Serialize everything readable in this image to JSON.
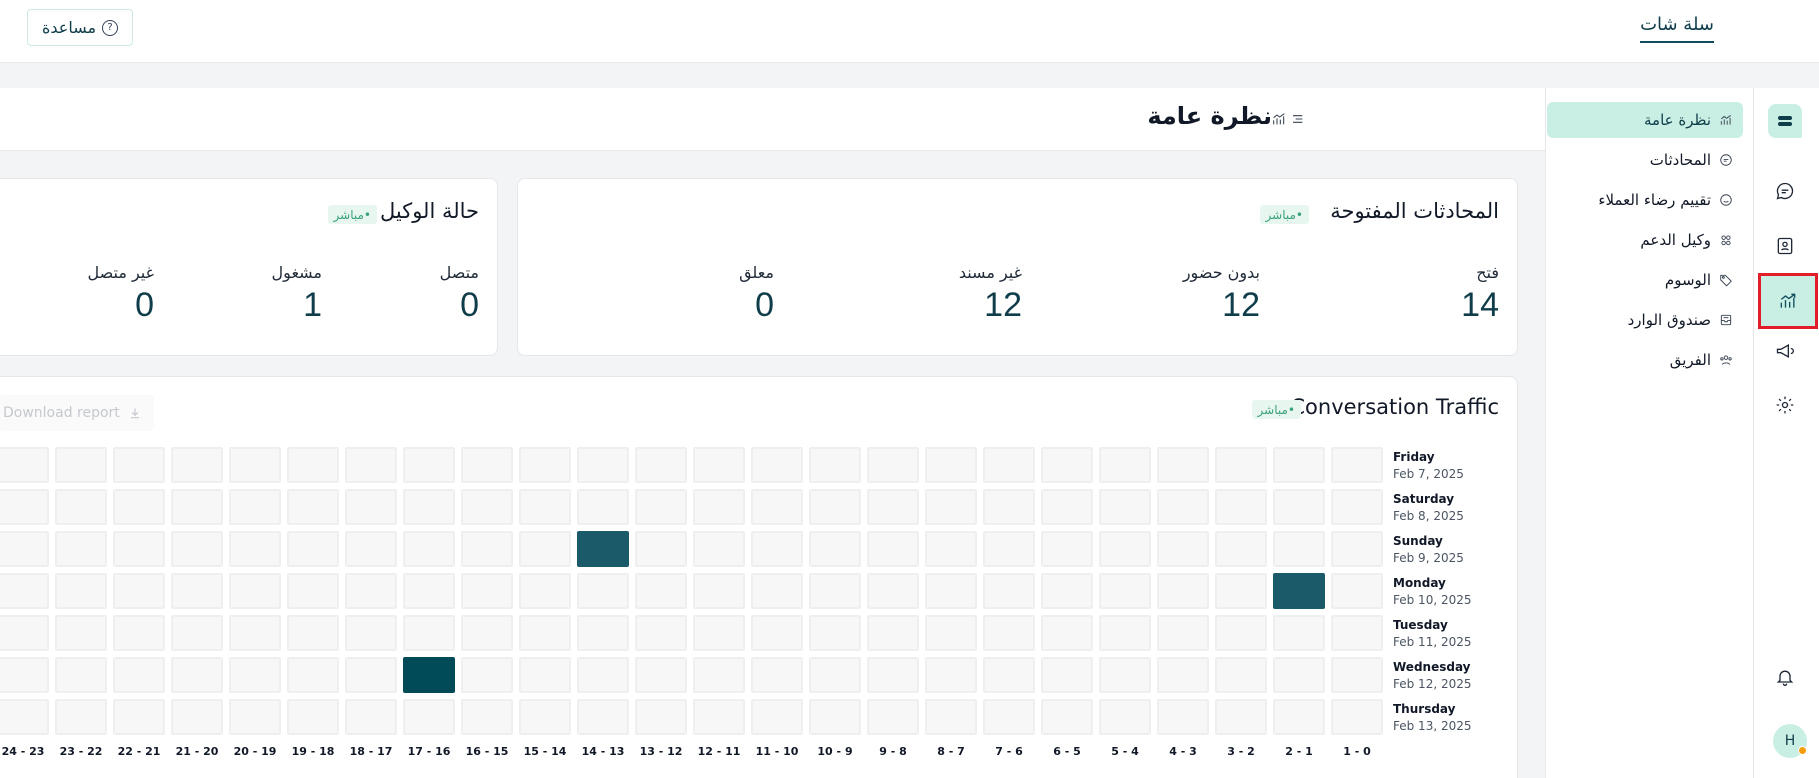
{
  "topbar": {
    "brand": "سلة شات",
    "help_label": "مساعدة",
    "help_icon": "?"
  },
  "rail": {
    "avatar_initial": "H"
  },
  "sidebar": {
    "items": [
      {
        "label": "نظرة عامة",
        "icon": "chart-trend-icon",
        "active": true
      },
      {
        "label": "المحادثات",
        "icon": "chat-icon"
      },
      {
        "label": "تقييم رضاء العملاء",
        "icon": "smile-icon"
      },
      {
        "label": "وكيل الدعم",
        "icon": "users-icon"
      },
      {
        "label": "الوسوم",
        "icon": "tag-icon"
      },
      {
        "label": "صندوق الوارد",
        "icon": "inbox-icon"
      },
      {
        "label": "الفريق",
        "icon": "team-icon"
      }
    ]
  },
  "page": {
    "title": "نظرة عامة"
  },
  "open_conversations": {
    "title": "المحادثات المفتوحة",
    "badge": "•مباشر",
    "metrics": [
      {
        "label": "فتح",
        "value": "14"
      },
      {
        "label": "بدون حضور",
        "value": "12"
      },
      {
        "label": "غير مسند",
        "value": "12"
      },
      {
        "label": "معلق",
        "value": "0"
      }
    ]
  },
  "agent_status": {
    "title": "حالة الوكيل",
    "badge": "•مباشر",
    "metrics": [
      {
        "label": "متصل",
        "value": "0"
      },
      {
        "label": "مشغول",
        "value": "1"
      },
      {
        "label": "غير متصل",
        "value": "0"
      }
    ]
  },
  "traffic": {
    "title": "Conversation Traffic",
    "badge": "•مباشر",
    "download_label": "Download report",
    "days": [
      {
        "day": "Friday",
        "date": "Feb 7, 2025"
      },
      {
        "day": "Saturday",
        "date": "Feb 8, 2025"
      },
      {
        "day": "Sunday",
        "date": "Feb 9, 2025"
      },
      {
        "day": "Monday",
        "date": "Feb 10, 2025"
      },
      {
        "day": "Tuesday",
        "date": "Feb 11, 2025"
      },
      {
        "day": "Wednesday",
        "date": "Feb 12, 2025"
      },
      {
        "day": "Thursday",
        "date": "Feb 13, 2025"
      }
    ],
    "hours": [
      "1 - 0",
      "2 - 1",
      "3 - 2",
      "4 - 3",
      "5 - 4",
      "6 - 5",
      "7 - 6",
      "8 - 7",
      "9 - 8",
      "10 - 9",
      "11 - 10",
      "12 - 11",
      "13 - 12",
      "14 - 13",
      "15 - 14",
      "16 - 15",
      "17 - 16",
      "18 - 17",
      "19 - 18",
      "20 - 19",
      "21 - 20",
      "22 - 21",
      "23 - 22",
      "24 - 23"
    ],
    "active_cells": [
      {
        "day_index": 2,
        "hour_index": 13,
        "level": 1
      },
      {
        "day_index": 3,
        "hour_index": 1,
        "level": 1
      },
      {
        "day_index": 5,
        "hour_index": 16,
        "level": 2
      }
    ]
  }
}
